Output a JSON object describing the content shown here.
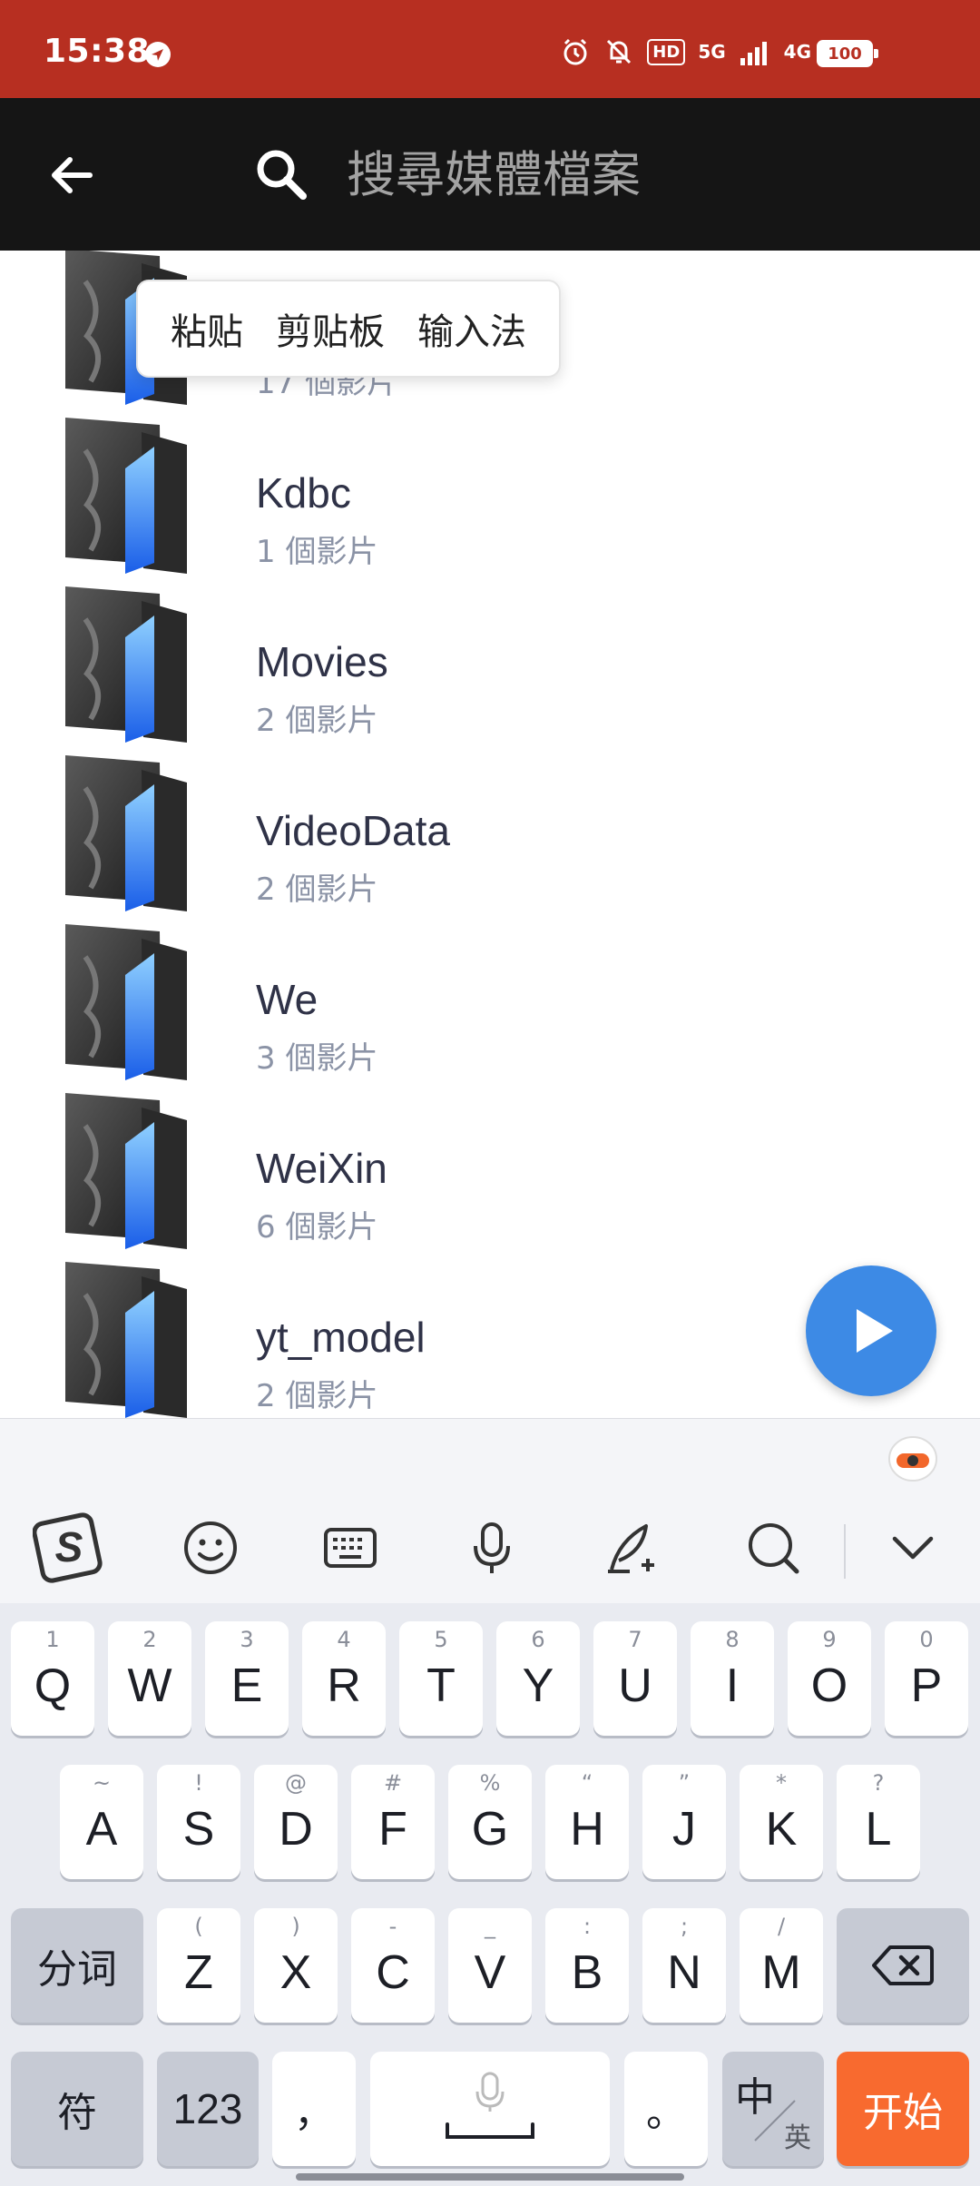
{
  "status_bar": {
    "time": "15:38",
    "network_5g": "5G",
    "network_4g": "4G",
    "battery": "100",
    "hd": "HD"
  },
  "toolbar": {
    "search_placeholder": "搜尋媒體檔案"
  },
  "context_menu": {
    "items": [
      "粘贴",
      "剪贴板",
      "输入法"
    ]
  },
  "folders": [
    {
      "name": "",
      "count": "17 個影片"
    },
    {
      "name": "Kdbc",
      "count": "1 個影片"
    },
    {
      "name": "Movies",
      "count": "2 個影片"
    },
    {
      "name": "VideoData",
      "count": "2 個影片"
    },
    {
      "name": "We",
      "count": "3 個影片"
    },
    {
      "name": "WeiXin",
      "count": "6 個影片"
    },
    {
      "name": "yt_model",
      "count": "2 個影片"
    }
  ],
  "keyboard": {
    "row1": [
      {
        "k": "Q",
        "h": "1"
      },
      {
        "k": "W",
        "h": "2"
      },
      {
        "k": "E",
        "h": "3"
      },
      {
        "k": "R",
        "h": "4"
      },
      {
        "k": "T",
        "h": "5"
      },
      {
        "k": "Y",
        "h": "6"
      },
      {
        "k": "U",
        "h": "7"
      },
      {
        "k": "I",
        "h": "8"
      },
      {
        "k": "O",
        "h": "9"
      },
      {
        "k": "P",
        "h": "0"
      }
    ],
    "row2": [
      {
        "k": "A",
        "h": "~"
      },
      {
        "k": "S",
        "h": "!"
      },
      {
        "k": "D",
        "h": "@"
      },
      {
        "k": "F",
        "h": "#"
      },
      {
        "k": "G",
        "h": "%"
      },
      {
        "k": "H",
        "h": "“"
      },
      {
        "k": "J",
        "h": "”"
      },
      {
        "k": "K",
        "h": "*"
      },
      {
        "k": "L",
        "h": "?"
      }
    ],
    "row3": [
      {
        "k": "Z",
        "h": "("
      },
      {
        "k": "X",
        "h": ")"
      },
      {
        "k": "C",
        "h": "-"
      },
      {
        "k": "V",
        "h": "_"
      },
      {
        "k": "B",
        "h": ":"
      },
      {
        "k": "N",
        "h": ";"
      },
      {
        "k": "M",
        "h": "/"
      }
    ],
    "segment_label": "分词",
    "symbol_label": "符",
    "num_label": "123",
    "comma_label": "，",
    "period_label": "。",
    "lang_main": "中",
    "lang_sub": "英",
    "enter_label": "开始"
  }
}
